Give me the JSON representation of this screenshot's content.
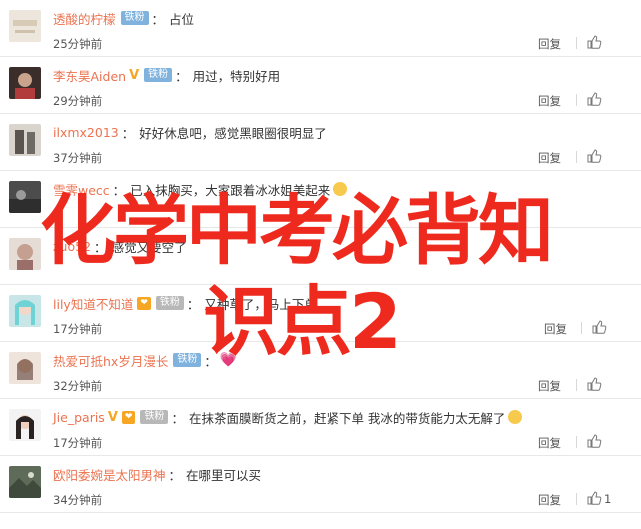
{
  "comments": [
    {
      "user": "透酸的柠檬",
      "badge": "铁粉",
      "text": "占位",
      "time": "25分钟前",
      "reply": "回复",
      "likes": ""
    },
    {
      "user": "李东昊Aiden",
      "badge": "铁粉",
      "text": "用过，特别好用",
      "time": "29分钟前",
      "reply": "回复",
      "likes": ""
    },
    {
      "user": "ilxmx2013",
      "badge": "",
      "text": "好好休息吧，感觉黑眼圈很明显了",
      "time": "37分钟前",
      "reply": "回复",
      "likes": ""
    },
    {
      "user": "雪霁wecc",
      "badge": "",
      "text": "已入抹胸买，大家跟着冰冰姐美起来",
      "time": "",
      "reply": "",
      "likes": ""
    },
    {
      "user": "zuo52",
      "badge": "",
      "text": "感觉又要空了",
      "time": "",
      "reply": "",
      "likes": ""
    },
    {
      "user": "lily知道不知道",
      "badge": "铁粉",
      "text": "又种草了，马上下单",
      "time": "17分钟前",
      "reply": "回复",
      "likes": ""
    },
    {
      "user": "热爱可抵hx岁月漫长",
      "badge": "铁粉",
      "text": "",
      "time": "32分钟前",
      "reply": "回复",
      "likes": ""
    },
    {
      "user": "Jie_paris",
      "badge": "铁粉",
      "text": "在抹茶面膜断货之前，赶紧下单 我冰的带货能力太无解了",
      "time": "17分钟前",
      "reply": "回复",
      "likes": ""
    },
    {
      "user": "欧阳委婉是太阳男神",
      "badge": "",
      "text": "在哪里可以买",
      "time": "34分钟前",
      "reply": "回复",
      "likes": "1"
    }
  ],
  "overlay": {
    "line1": "化学中考必背知",
    "line2": "识点2"
  },
  "colors": {
    "username": "#eb7350",
    "overlay_text": "#ee2a1e",
    "fan_badge": "#7fb2dd",
    "vip": "#f6a623"
  },
  "icons": [
    "like-thumb-icon",
    "verified-v-icon",
    "vip-badge-icon",
    "emoji-icon"
  ]
}
